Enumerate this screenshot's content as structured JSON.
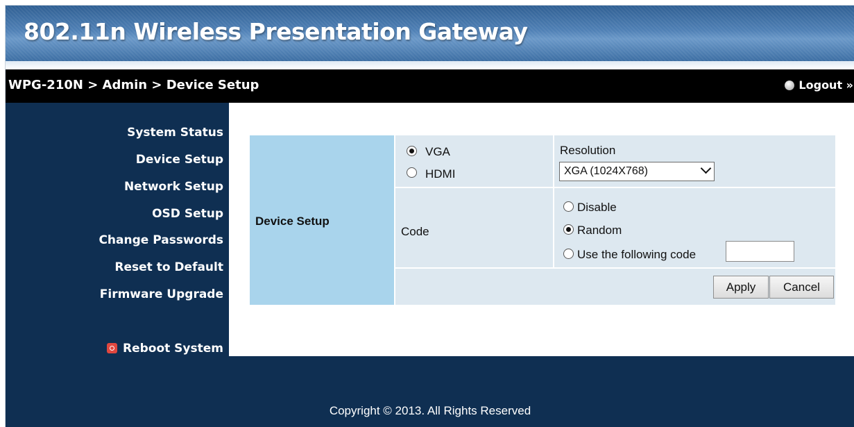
{
  "header": {
    "title": "802.11n Wireless Presentation Gateway"
  },
  "navbar": {
    "breadcrumb": "WPG-210N > Admin > Device Setup",
    "logout_label": "Logout »"
  },
  "sidebar": {
    "items": [
      {
        "label": "System Status"
      },
      {
        "label": "Device Setup"
      },
      {
        "label": "Network Setup"
      },
      {
        "label": "OSD Setup"
      },
      {
        "label": "Change Passwords"
      },
      {
        "label": "Reset to Default"
      },
      {
        "label": "Firmware Upgrade"
      }
    ],
    "reboot_label": "Reboot System"
  },
  "form": {
    "section_label": "Device Setup",
    "output": {
      "options": [
        "VGA",
        "HDMI"
      ],
      "selected": "VGA"
    },
    "resolution": {
      "label": "Resolution",
      "value": "XGA (1024X768)"
    },
    "code": {
      "label": "Code",
      "options": [
        "Disable",
        "Random",
        "Use the following code"
      ],
      "selected": "Random",
      "custom_value": ""
    },
    "apply_label": "Apply",
    "cancel_label": "Cancel"
  },
  "footer": {
    "copyright": "Copyright © 2013. All Rights Reserved"
  },
  "colors": {
    "banner": "#3c6ea3",
    "sidebar": "#0f2f52",
    "label_cell": "#a9d4ec",
    "light_cell": "#dde8f0"
  }
}
